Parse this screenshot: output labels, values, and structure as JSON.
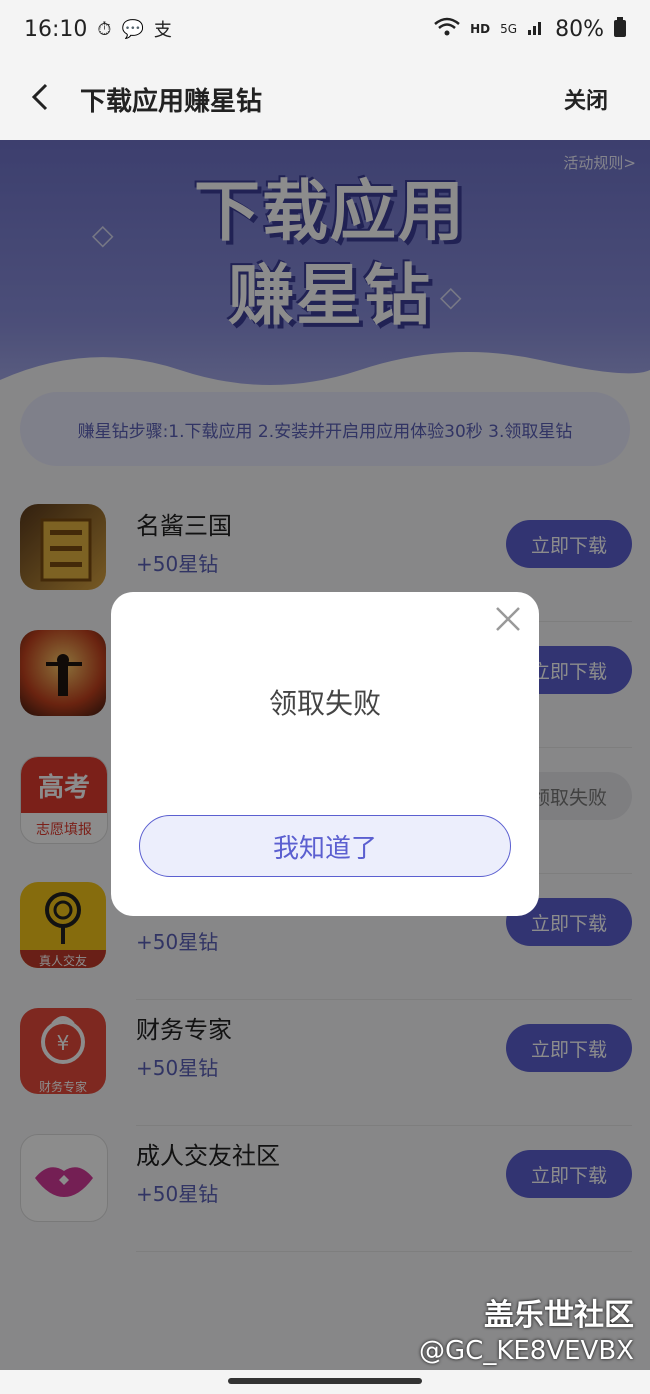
{
  "status_bar": {
    "time": "16:10",
    "hd": "HD",
    "network": "5G",
    "battery": "80%"
  },
  "navbar": {
    "title": "下载应用赚星钻",
    "close_label": "关闭"
  },
  "banner": {
    "rules_link": "活动规则>",
    "title_line1": "下载应用",
    "title_line2": "赚星钻"
  },
  "steps_text": "赚星钻步骤:1.下载应用 2.安装并开启用应用体验30秒 3.领取星钻",
  "apps": [
    {
      "name": "名酱三国",
      "reward": "+50星钻",
      "button": "立即下载",
      "icon": "three-kingdoms-icon",
      "state": "download"
    },
    {
      "name": "",
      "reward": "",
      "button": "立即下载",
      "icon": "sunset-warrior-icon",
      "state": "download"
    },
    {
      "name": "",
      "reward": "",
      "button": "领取失败",
      "icon": "gaokao-icon",
      "icon_text_top": "高考",
      "icon_text_bottom": "志愿填报",
      "state": "failed"
    },
    {
      "name": "",
      "reward": "+50星钻",
      "button": "立即下载",
      "icon": "lollipop-icon",
      "icon_text_bottom": "真人交友",
      "state": "download"
    },
    {
      "name": "财务专家",
      "reward": "+50星钻",
      "button": "立即下载",
      "icon": "finance-bag-icon",
      "icon_text_bottom": "财务专家",
      "state": "download"
    },
    {
      "name": "成人交友社区",
      "reward": "+50星钻",
      "button": "立即下载",
      "icon": "lips-icon",
      "state": "download"
    }
  ],
  "dialog": {
    "message": "领取失败",
    "confirm_label": "我知道了"
  },
  "watermark": {
    "line1": "盖乐世社区",
    "line2": "@GC_KE8VEVBX"
  },
  "colors": {
    "accent": "#5b5fd0",
    "banner": "#7b80d6"
  }
}
